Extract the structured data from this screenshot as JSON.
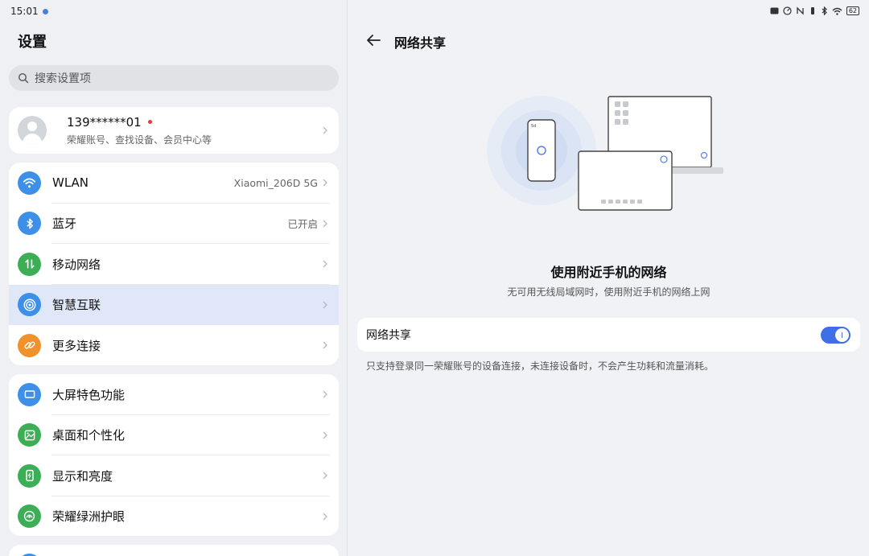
{
  "status": {
    "time": "15:01",
    "battery": "62"
  },
  "left": {
    "title": "设置",
    "search_placeholder": "搜索设置项",
    "account": {
      "name": "139******01",
      "subtitle": "荣耀账号、查找设备、会员中心等"
    },
    "group1": [
      {
        "label": "WLAN",
        "value": "Xiaomi_206D 5G",
        "icon": "wifi-icon",
        "color": "#3d8fe8"
      },
      {
        "label": "蓝牙",
        "value": "已开启",
        "icon": "bluetooth-icon",
        "color": "#3d8fe8"
      },
      {
        "label": "移动网络",
        "value": "",
        "icon": "mobile-data-icon",
        "color": "#3cae55"
      },
      {
        "label": "智慧互联",
        "value": "",
        "icon": "smart-connect-icon",
        "color": "#3d8fe8"
      },
      {
        "label": "更多连接",
        "value": "",
        "icon": "link-icon",
        "color": "#f0912c"
      }
    ],
    "group2": [
      {
        "label": "大屏特色功能",
        "icon": "tablet-icon",
        "color": "#3d8fe8"
      },
      {
        "label": "桌面和个性化",
        "icon": "wallpaper-icon",
        "color": "#3cae55"
      },
      {
        "label": "显示和亮度",
        "icon": "display-icon",
        "color": "#3cae55"
      },
      {
        "label": "荣耀绿洲护眼",
        "icon": "eye-care-icon",
        "color": "#3cae55"
      }
    ]
  },
  "right": {
    "title": "网络共享",
    "feature_title": "使用附近手机的网络",
    "feature_subtitle": "无可用无线局域网时，使用附近手机的网络上网",
    "toggle_label": "网络共享",
    "toggle_on": true,
    "note": "只支持登录同一荣耀账号的设备连接，未连接设备时，不会产生功耗和流量消耗。",
    "phone_signal": "5d"
  },
  "colors": {
    "accent": "#3e6fe6",
    "active_row": "#dfe7f8"
  }
}
